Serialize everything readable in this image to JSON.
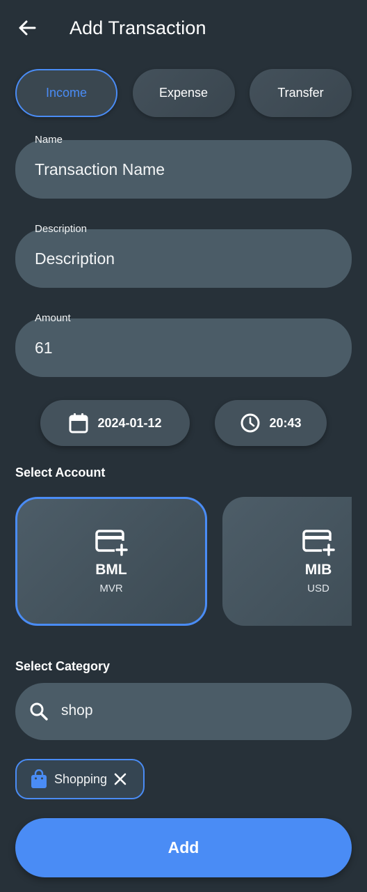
{
  "header": {
    "title": "Add Transaction",
    "back_icon": "arrow-left-icon"
  },
  "transaction_types": [
    {
      "label": "Income",
      "selected": true
    },
    {
      "label": "Expense",
      "selected": false
    },
    {
      "label": "Transfer",
      "selected": false
    }
  ],
  "fields": {
    "name": {
      "label": "Name",
      "value": "",
      "placeholder": "Transaction Name"
    },
    "description": {
      "label": "Description",
      "value": "",
      "placeholder": "Description"
    },
    "amount": {
      "label": "Amount",
      "value": "61",
      "placeholder": ""
    }
  },
  "datetime": {
    "date": "2024-01-12",
    "date_icon": "calendar-icon",
    "time": "20:43",
    "time_icon": "clock-icon"
  },
  "accounts": {
    "title": "Select Account",
    "items": [
      {
        "name": "BML",
        "currency": "MVR",
        "icon": "card-plus-icon",
        "selected": true
      },
      {
        "name": "MIB",
        "currency": "USD",
        "icon": "card-plus-icon",
        "selected": false
      }
    ]
  },
  "category": {
    "title": "Select Category",
    "search_value": "shop",
    "search_icon": "search-icon",
    "selected_chip": {
      "label": "Shopping",
      "icon": "shopping-bag-icon",
      "close_icon": "close-icon"
    }
  },
  "actions": {
    "add_label": "Add"
  },
  "colors": {
    "background": "#273139",
    "accent": "#4a8cf5",
    "field": "#4b5c67"
  }
}
